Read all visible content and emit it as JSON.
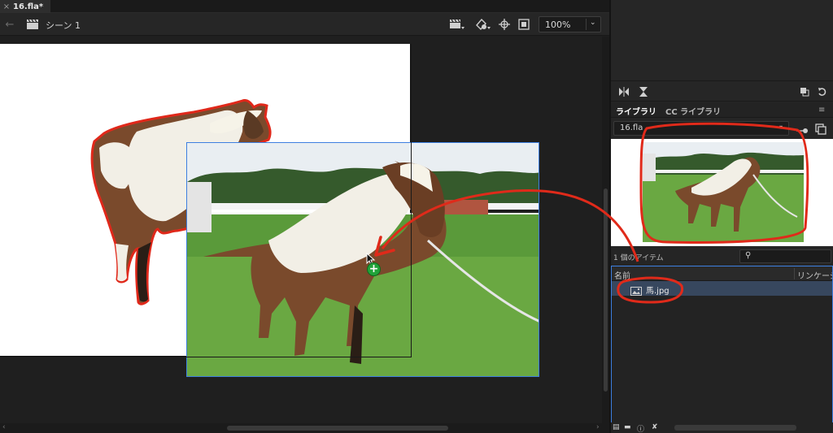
{
  "document_tab": {
    "close": "×",
    "title": "16.fla*"
  },
  "toolbar": {
    "scene_label": "シーン 1",
    "zoom_value": "100%",
    "zoom_chevron": "⌄"
  },
  "library": {
    "tabs": [
      "ライブラリ",
      "CC ライブラリ"
    ],
    "document_select": "16.fla",
    "item_count_text": "1 個のアイテム",
    "columns": {
      "name": "名前",
      "linkage": "リンケージ"
    },
    "items": [
      {
        "name": "馬.jpg",
        "icon": "image-icon"
      }
    ]
  },
  "colors": {
    "annotation": "#e02a1a",
    "selection": "#3d7fe0",
    "add_badge": "#21a33a"
  }
}
